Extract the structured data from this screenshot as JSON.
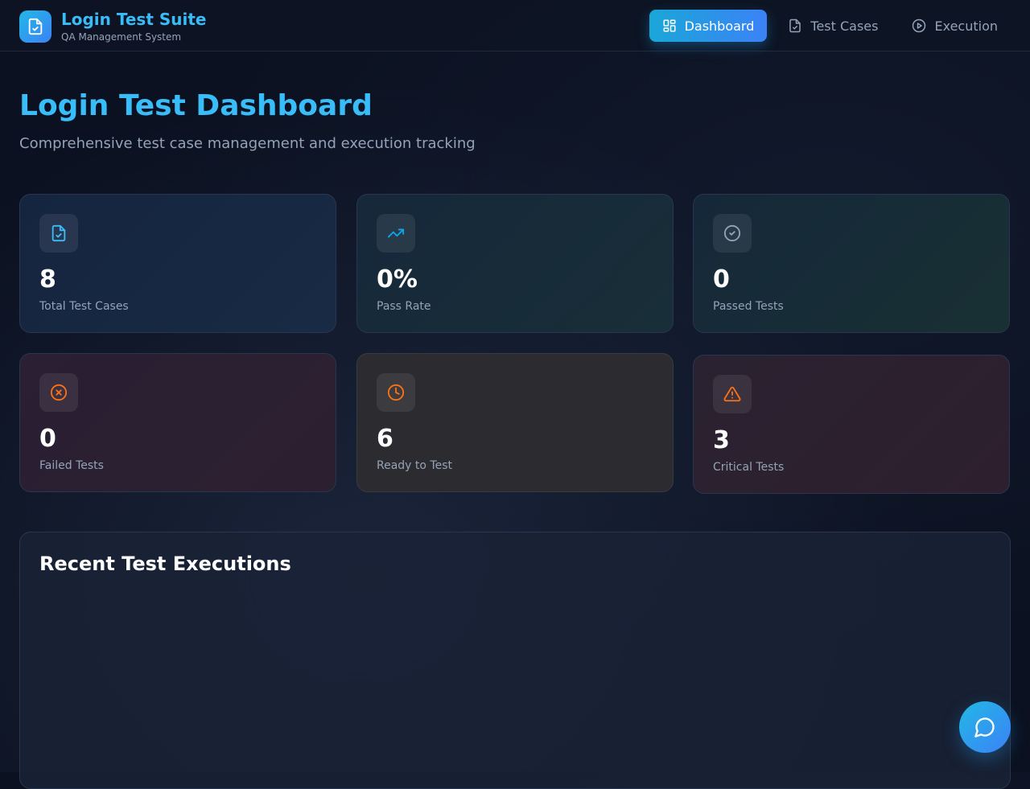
{
  "brand": {
    "title": "Login Test Suite",
    "subtitle": "QA Management System",
    "icon": "file-check-icon"
  },
  "nav": {
    "items": [
      {
        "label": "Dashboard",
        "icon": "layout-grid-icon",
        "active": true
      },
      {
        "label": "Test Cases",
        "icon": "file-check-icon",
        "active": false
      },
      {
        "label": "Execution",
        "icon": "play-circle-icon",
        "active": false
      }
    ]
  },
  "header": {
    "title": "Login Test Dashboard",
    "subtitle": "Comprehensive test case management and execution tracking"
  },
  "stats": [
    {
      "value": "8",
      "label": "Total Test Cases",
      "icon": "file-check-icon",
      "color": "#38bdf8"
    },
    {
      "value": "0%",
      "label": "Pass Rate",
      "icon": "trending-up-icon",
      "color": "#0ea5e9"
    },
    {
      "value": "0",
      "label": "Passed Tests",
      "icon": "check-circle-icon",
      "color": "#94a3b8"
    },
    {
      "value": "0",
      "label": "Failed Tests",
      "icon": "x-circle-icon",
      "color": "#f97316"
    },
    {
      "value": "6",
      "label": "Ready to Test",
      "icon": "clock-icon",
      "color": "#f97316"
    },
    {
      "value": "3",
      "label": "Critical Tests",
      "icon": "alert-triangle-icon",
      "color": "#f97316"
    }
  ],
  "recent": {
    "title": "Recent Test Executions"
  },
  "chat": {
    "icon": "chat-bubble-icon"
  },
  "colors": {
    "accent": "#38bdf8",
    "accent_gradient_end": "#3b82f6",
    "background": "#0b1120"
  }
}
